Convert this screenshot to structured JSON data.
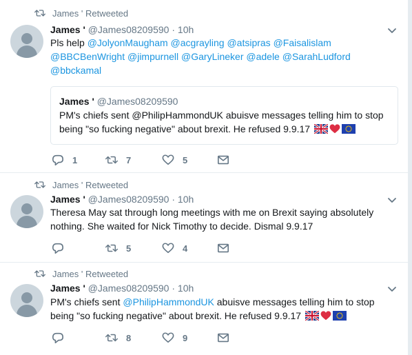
{
  "tweets": [
    {
      "retweet_label": "James ' Retweeted",
      "name": "James '",
      "handle": "@James08209590",
      "sep": "·",
      "time": "10h",
      "text_prefix": "Pls help ",
      "mentions": [
        "@JolyonMaugham",
        "@acgrayling",
        "@atsipras",
        "@Faisalislam",
        "@BBCBenWright",
        "@jimpurnell",
        "@GaryLineker",
        "@adele",
        "@SarahLudford",
        "@bbckamal"
      ],
      "quote": {
        "name": "James '",
        "handle": "@James08209590",
        "text": "PM's chiefs sent @PhilipHammondUK abuisve messages telling him to stop being \"so fucking negative\" about brexit. He refused 9.9.17"
      },
      "replies": "1",
      "retweets": "7",
      "likes": "5"
    },
    {
      "retweet_label": "James ' Retweeted",
      "name": "James '",
      "handle": "@James08209590",
      "sep": "·",
      "time": "10h",
      "text": "Theresa May sat through long meetings with me on Brexit saying absolutely nothing. She waited for Nick Timothy to decide. Dismal 9.9.17",
      "replies": "",
      "retweets": "5",
      "likes": "4"
    },
    {
      "retweet_label": "James ' Retweeted",
      "name": "James '",
      "handle": "@James08209590",
      "sep": "·",
      "time": "10h",
      "text_prefix": "PM's chiefs sent ",
      "mention": "@PhilipHammondUK",
      "text_suffix": " abuisve messages telling him to stop being \"so fucking negative\" about brexit. He refused 9.9.17",
      "replies": "",
      "retweets": "8",
      "likes": "9"
    }
  ],
  "colors": {
    "link": "#1b95e0",
    "muted": "#657786",
    "border": "#e6ecf0",
    "heart": "#e0245e"
  },
  "icons": [
    "retweet-icon",
    "chevron-down-icon",
    "reply-icon",
    "like-icon",
    "dm-icon",
    "avatar-icon",
    "uk-flag-icon",
    "heart-emoji-icon",
    "eu-flag-icon"
  ]
}
